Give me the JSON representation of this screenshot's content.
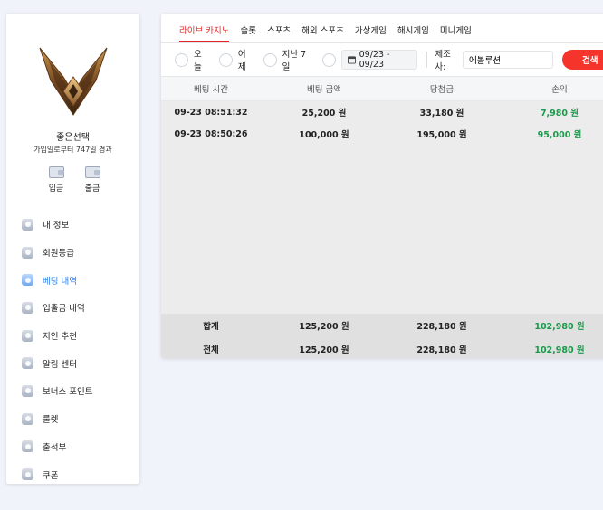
{
  "profile": {
    "username": "좋은선택",
    "since": "가입일로부터 747일 경과"
  },
  "wallet": {
    "deposit_label": "입금",
    "withdraw_label": "출금"
  },
  "menu": [
    {
      "label": "내 정보",
      "icon": "user-icon"
    },
    {
      "label": "회원등급",
      "icon": "grade-icon"
    },
    {
      "label": "베팅 내역",
      "icon": "betting-history-icon",
      "active": true
    },
    {
      "label": "입출금 내역",
      "icon": "wallet-icon"
    },
    {
      "label": "지인 추천",
      "icon": "referral-icon"
    },
    {
      "label": "알림 센터",
      "icon": "chat-icon"
    },
    {
      "label": "보너스 포인트",
      "icon": "points-icon"
    },
    {
      "label": "룰렛",
      "icon": "roulette-icon"
    },
    {
      "label": "출석부",
      "icon": "attendance-icon"
    },
    {
      "label": "쿠폰",
      "icon": "coupon-icon"
    }
  ],
  "tabs": [
    {
      "label": "라이브 카지노",
      "active": true
    },
    {
      "label": "슬롯"
    },
    {
      "label": "스포츠"
    },
    {
      "label": "해외 스포츠"
    },
    {
      "label": "가상게임"
    },
    {
      "label": "해시게임"
    },
    {
      "label": "미니게임"
    }
  ],
  "filters": {
    "today": "오늘",
    "yesterday": "어제",
    "last7": "지난 7일",
    "date_range": "09/23 - 09/23",
    "provider_label": "제조사:",
    "provider_value": "에볼루션",
    "search_label": "검색"
  },
  "table": {
    "headers": [
      "베팅 시간",
      "베팅 금액",
      "당첨금",
      "손익"
    ],
    "rows": [
      {
        "time": "09-23 08:51:32",
        "bet": "25,200 원",
        "win": "33,180 원",
        "profit": "7,980 원"
      },
      {
        "time": "09-23 08:50:26",
        "bet": "100,000 원",
        "win": "195,000 원",
        "profit": "95,000 원"
      }
    ],
    "subtotal": {
      "label": "합계",
      "bet": "125,200 원",
      "win": "228,180 원",
      "profit": "102,980 원"
    },
    "total": {
      "label": "전체",
      "bet": "125,200 원",
      "win": "228,180 원",
      "profit": "102,980 원"
    }
  },
  "colors": {
    "accent_red": "#f5352b",
    "active_blue": "#2b7de9",
    "profit_green": "#1a9a4a"
  }
}
